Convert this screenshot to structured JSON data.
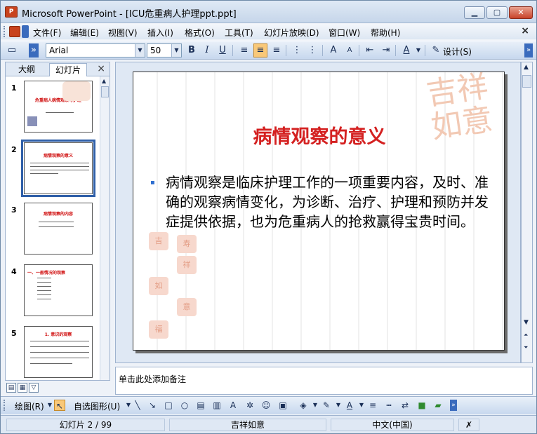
{
  "window": {
    "title": "Microsoft PowerPoint - [ICU危重病人护理ppt.ppt]",
    "app_icon_letter": "P",
    "controls": {
      "minimize": "▁",
      "maximize": "▢",
      "close": "✕"
    }
  },
  "menu": {
    "items": [
      "文件(F)",
      "编辑(E)",
      "视图(V)",
      "插入(I)",
      "格式(O)",
      "工具(T)",
      "幻灯片放映(D)",
      "窗口(W)",
      "帮助(H)"
    ],
    "close": "×"
  },
  "toolbar": {
    "font": "Arial",
    "size": "50",
    "bold": "B",
    "italic": "I",
    "underline": "U",
    "design_label": "设计(S)",
    "font_color_glyph": "A"
  },
  "left_pane": {
    "tabs": [
      "大纲",
      "幻灯片"
    ],
    "close": "×",
    "slides": [
      {
        "num": "1",
        "title": "危重病人病情观察与护理"
      },
      {
        "num": "2",
        "title": "病情观察的意义"
      },
      {
        "num": "3",
        "title": "病情观察的内容"
      },
      {
        "num": "4",
        "title": "一、一般情况的观察"
      },
      {
        "num": "5",
        "title": "1. 意识的观察"
      }
    ]
  },
  "slide": {
    "title": "病情观察的意义",
    "bullet": "▪",
    "body": "病情观察是临床护理工作的一项重要内容，及时、准确的观察病情变化，为诊断、治疗、护理和预防并发症提供依据，也为危重病人的抢救赢得宝贵时间。",
    "decoration": "吉祥如意",
    "seals": [
      "吉",
      "祥",
      "如",
      "意",
      "福",
      "寿"
    ]
  },
  "notes": {
    "placeholder": "单击此处添加备注"
  },
  "drawing_toolbar": {
    "draw_label": "绘图(R)",
    "autoshape_label": "自选图形(U)"
  },
  "status": {
    "slide": "幻灯片 2 / 99",
    "template": "吉祥如意",
    "language": "中文(中国)"
  }
}
